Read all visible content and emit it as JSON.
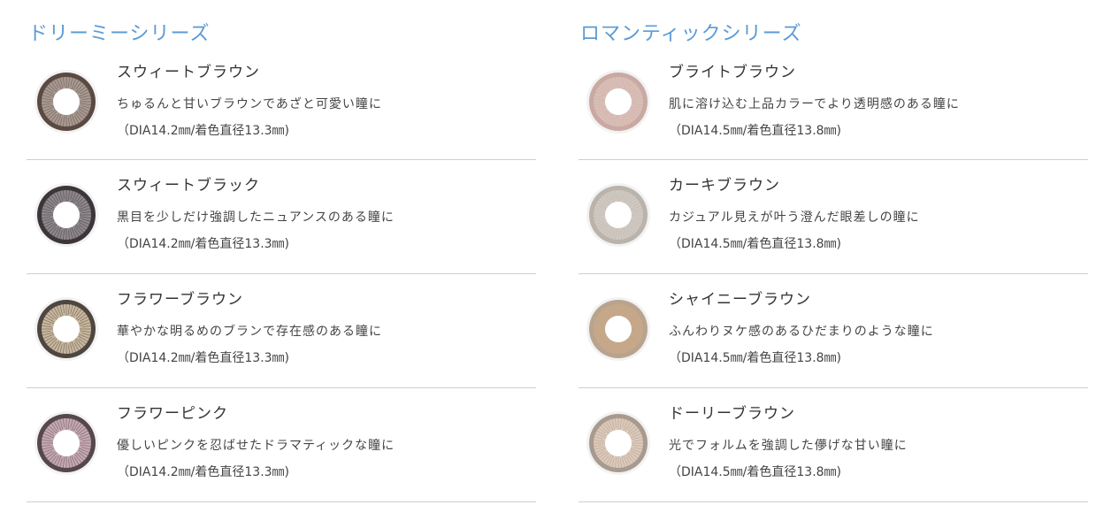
{
  "series": [
    {
      "title": "ドリーミーシリーズ",
      "products": [
        {
          "name": "スウィートブラウン",
          "description": "ちゅるんと甘いブラウンであざと可愛い瞳に",
          "spec": "（DIA14.2㎜/着色直径13.3㎜)",
          "ring_color": "#5a4a42",
          "inner_color": "#a89a92",
          "icon": "lens-icon"
        },
        {
          "name": "スウィートブラック",
          "description": "黒目を少しだけ強調したニュアンスのある瞳に",
          "spec": "（DIA14.2㎜/着色直径13.3㎜)",
          "ring_color": "#3c363a",
          "inner_color": "#8e878c",
          "icon": "lens-icon"
        },
        {
          "name": "フラワーブラウン",
          "description": "華やかな明るめのブランで存在感のある瞳に",
          "spec": "（DIA14.2㎜/着色直径13.3㎜)",
          "ring_color": "#4e4640",
          "inner_color": "#c9b79e",
          "icon": "lens-icon"
        },
        {
          "name": "フラワーピンク",
          "description": "優しいピンクを忍ばせたドラマティックな瞳に",
          "spec": "（DIA14.2㎜/着色直径13.3㎜)",
          "ring_color": "#55484c",
          "inner_color": "#c6a9b2",
          "icon": "lens-icon"
        }
      ]
    },
    {
      "title": "ロマンティックシリーズ",
      "products": [
        {
          "name": "ブライトブラウン",
          "description": "肌に溶け込む上品カラーでより透明感のある瞳に",
          "spec": "（DIA14.5㎜/着色直径13.8㎜)",
          "ring_color": "#c9a9a2",
          "inner_color": "#d9bfb7",
          "icon": "lens-icon"
        },
        {
          "name": "カーキブラウン",
          "description": "カジュアル見えが叶う澄んだ眼差しの瞳に",
          "spec": "（DIA14.5㎜/着色直径13.8㎜)",
          "ring_color": "#b9b3ab",
          "inner_color": "#cfc9c1",
          "icon": "lens-icon"
        },
        {
          "name": "シャイニーブラウン",
          "description": "ふんわりヌケ感のあるひだまりのような瞳に",
          "spec": "（DIA14.5㎜/着色直径13.8㎜)",
          "ring_color": "#b8a48e",
          "inner_color": "#c8a888",
          "icon": "lens-icon"
        },
        {
          "name": "ドーリーブラウン",
          "description": "光でフォルムを強調した儚げな甘い瞳に",
          "spec": "（DIA14.5㎜/着色直径13.8㎜)",
          "ring_color": "#a89a8e",
          "inner_color": "#dcc9b9",
          "icon": "lens-icon"
        }
      ]
    }
  ]
}
